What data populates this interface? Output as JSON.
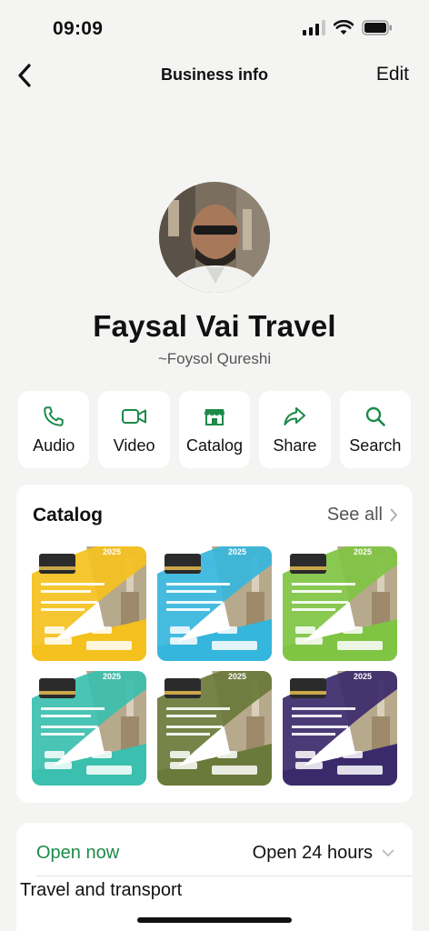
{
  "status_bar": {
    "time": "09:09"
  },
  "nav": {
    "title": "Business info",
    "edit_label": "Edit"
  },
  "profile": {
    "name": "Faysal Vai Travel",
    "subtitle": "~Foysol Qureshi"
  },
  "actions": [
    {
      "label": "Audio",
      "icon": "phone-icon"
    },
    {
      "label": "Video",
      "icon": "video-camera-icon"
    },
    {
      "label": "Catalog",
      "icon": "storefront-icon"
    },
    {
      "label": "Share",
      "icon": "share-arrow-icon"
    },
    {
      "label": "Search",
      "icon": "search-icon"
    }
  ],
  "catalog": {
    "title": "Catalog",
    "see_all_label": "See all",
    "items": [
      {
        "year": "2025",
        "accent": "#f5c11e"
      },
      {
        "year": "2025",
        "accent": "#35b6dc"
      },
      {
        "year": "2025",
        "accent": "#7fc443"
      },
      {
        "year": "2025",
        "accent": "#3bbfae"
      },
      {
        "year": "2025",
        "accent": "#6a7a3a"
      },
      {
        "year": "2025",
        "accent": "#3b2a6b"
      }
    ]
  },
  "hours": {
    "status": "Open now",
    "detail": "Open 24 hours"
  },
  "business_category": "Travel and transport",
  "colors": {
    "brand_green": "#1c8a48",
    "background": "#f4f4f3"
  }
}
